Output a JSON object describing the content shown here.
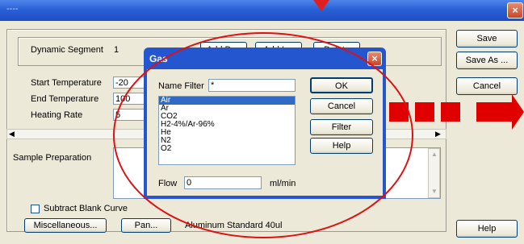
{
  "window": {
    "title": "----",
    "close_glyph": "×"
  },
  "segment": {
    "label": "Dynamic Segment",
    "number": "1",
    "add_dyn": "Add Dyn",
    "add_iso": "Add Iso",
    "delete": "Delete"
  },
  "params": {
    "start_temp_label": "Start Temperature",
    "start_temp_value": "-20",
    "end_temp_label": "End Temperature",
    "end_temp_value": "100",
    "heating_rate_label": "Heating Rate",
    "heating_rate_value": "5"
  },
  "sample": {
    "label": "Sample Preparation"
  },
  "bottom": {
    "subtract_blank": "Subtract Blank Curve",
    "misc_button": "Miscellaneous...",
    "pan_button": "Pan...",
    "pan_value": "Aluminum Standard 40ul"
  },
  "right_buttons": {
    "save": "Save",
    "save_as": "Save As ...",
    "cancel": "Cancel",
    "help": "Help"
  },
  "gas_dialog": {
    "title": "Gas",
    "name_filter_label": "Name Filter",
    "name_filter_value": "*",
    "items": [
      "Air",
      "Ar",
      "CO2",
      "H2-4%/Ar-96%",
      "He",
      "N2",
      "O2"
    ],
    "selected_index": 0,
    "flow_label": "Flow",
    "flow_value": "0",
    "flow_unit": "ml/min",
    "ok": "OK",
    "cancel": "Cancel",
    "filter": "Filter",
    "help": "Help"
  },
  "colors": {
    "accent_red": "#e00000",
    "title_blue": "#2456cf",
    "selection": "#316ac5"
  }
}
